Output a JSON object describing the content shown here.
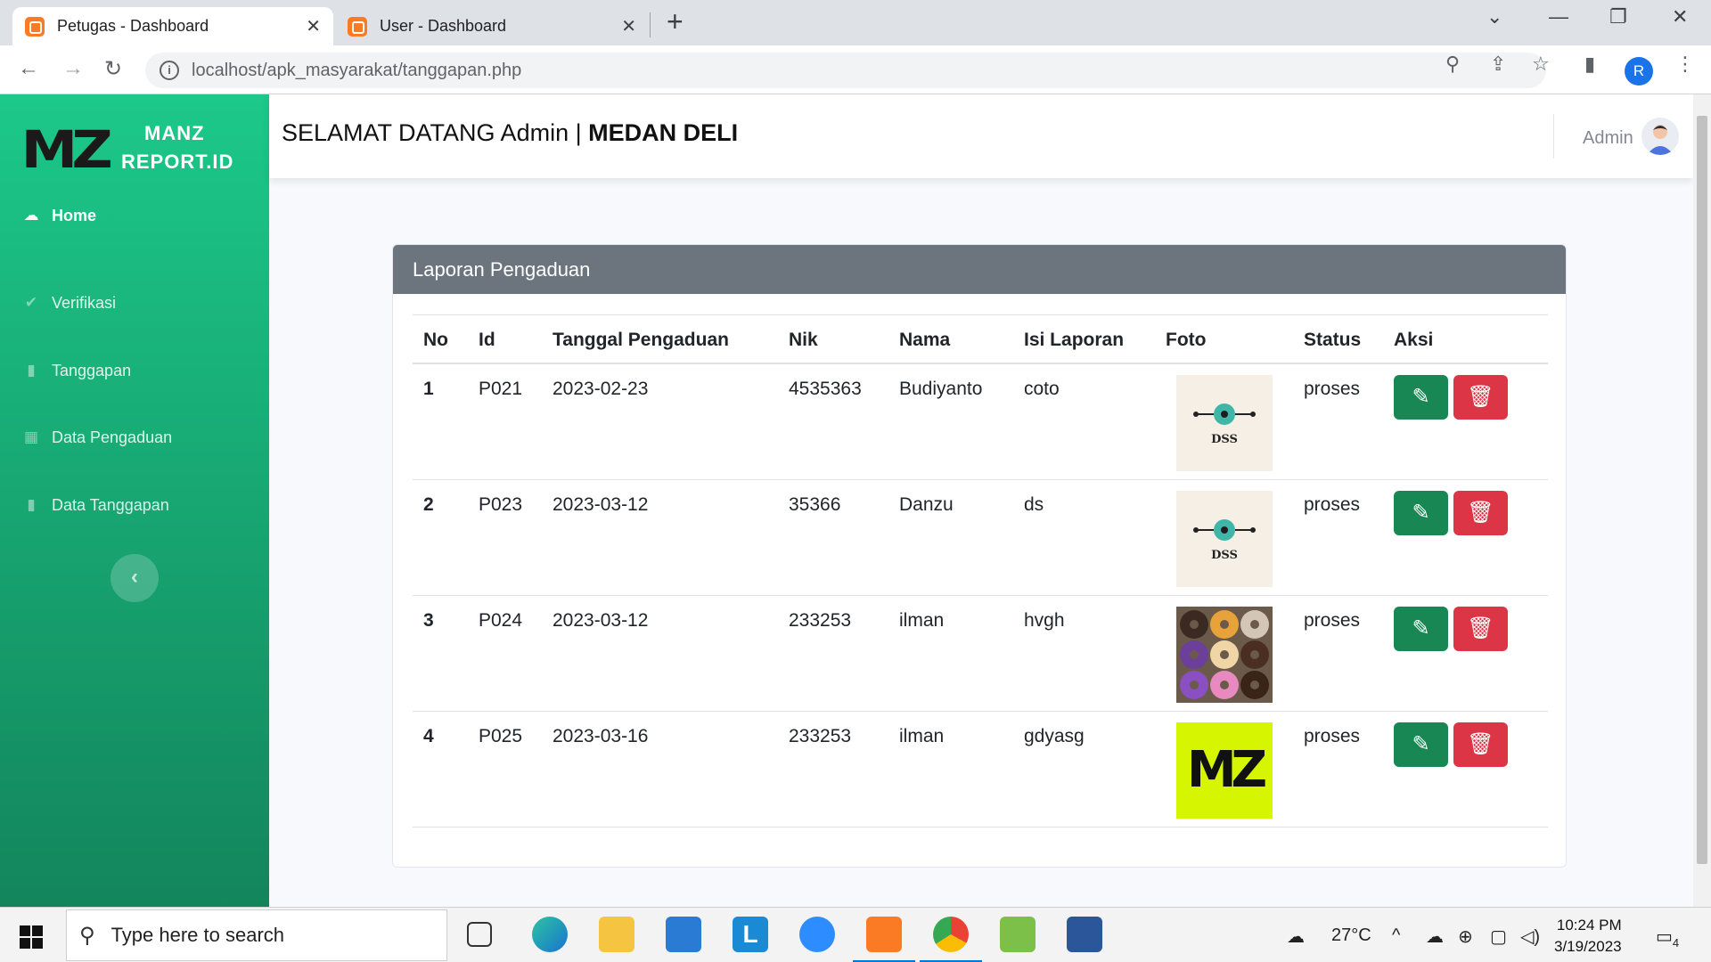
{
  "browser": {
    "tabs": [
      {
        "title": "Petugas - Dashboard",
        "active": true
      },
      {
        "title": "User - Dashboard",
        "active": false
      }
    ],
    "url_host": "localhost",
    "url_path": "/apk_masyarakat/tanggapan.php",
    "profile_initial": "R"
  },
  "app": {
    "brand_line1": "MANZ",
    "brand_line2": "REPORT.ID",
    "brand_logo": "MZ",
    "welcome_prefix": "SELAMAT DATANG Admin | ",
    "welcome_place": "MEDAN DELI",
    "user_name": "Admin"
  },
  "sidebar": {
    "items": [
      {
        "label": "Home",
        "icon": "home-icon",
        "active": true
      },
      {
        "label": "Verifikasi",
        "icon": "check-icon"
      },
      {
        "label": "Tanggapan",
        "icon": "clipboard-icon"
      },
      {
        "label": "Data Pengaduan",
        "icon": "table-icon"
      },
      {
        "label": "Data Tanggapan",
        "icon": "file-icon"
      }
    ]
  },
  "card": {
    "title": "Laporan Pengaduan",
    "columns": [
      "No",
      "Id",
      "Tanggal Pengaduan",
      "Nik",
      "Nama",
      "Isi Laporan",
      "Foto",
      "Status",
      "Aksi"
    ],
    "rows": [
      {
        "no": "1",
        "id": "P021",
        "tanggal": "2023-02-23",
        "nik": "4535363",
        "nama": "Budiyanto",
        "isi": "coto",
        "foto": "dss-logo",
        "status": "proses"
      },
      {
        "no": "2",
        "id": "P023",
        "tanggal": "2023-03-12",
        "nik": "35366",
        "nama": "Danzu",
        "isi": "ds",
        "foto": "dss-logo",
        "status": "proses"
      },
      {
        "no": "3",
        "id": "P024",
        "tanggal": "2023-03-12",
        "nik": "233253",
        "nama": "ilman",
        "isi": "hvgh",
        "foto": "donuts-photo",
        "status": "proses"
      },
      {
        "no": "4",
        "id": "P025",
        "tanggal": "2023-03-16",
        "nik": "233253",
        "nama": "ilman",
        "isi": "gdyasg",
        "foto": "mz-logo",
        "status": "proses"
      }
    ]
  },
  "taskbar": {
    "search_placeholder": "Type here to search",
    "temperature": "27°C",
    "time": "10:24 PM",
    "date": "3/19/2023",
    "notification_count": "4"
  },
  "colors": {
    "sidebar_top": "#1cc88a",
    "sidebar_bottom": "#13855c",
    "card_header": "#6c757d",
    "edit_button": "#198754",
    "delete_button": "#dc3545",
    "mz_logo_bg": "#d6f500"
  }
}
